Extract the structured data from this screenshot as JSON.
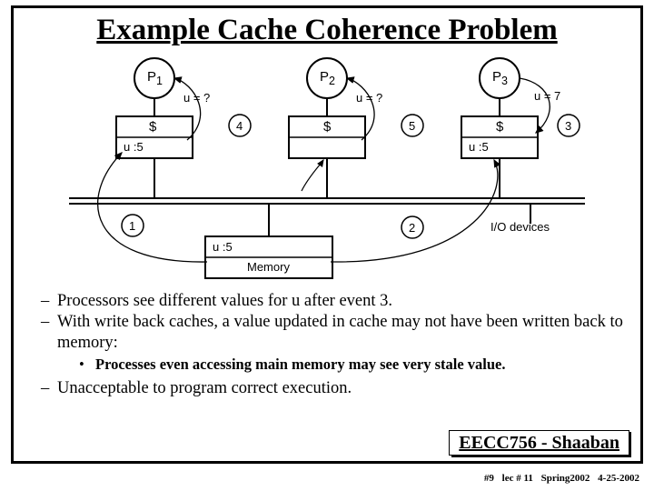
{
  "title": "Example Cache Coherence Problem",
  "diagram": {
    "proc1": "P",
    "proc1_sub": "1",
    "proc2": "P",
    "proc2_sub": "2",
    "proc3": "P",
    "proc3_sub": "3",
    "u_q1": "u = ?",
    "u_q2": "u = ?",
    "u_7": "u = 7",
    "cache1_line": "u :5",
    "cache2_label": "$",
    "cache1_label": "$",
    "cache3_label": "$",
    "cache3_line": "u :5",
    "step1": "1",
    "step2": "2",
    "step3": "3",
    "step4": "4",
    "step5": "5",
    "io": "I/O devices",
    "memory_label": "Memory",
    "memory_line": "u :5"
  },
  "bullets": {
    "b1": "Processors see different values for  u   after event 3.",
    "b2": "With write back caches, a value updated in cache may not have been written back to memory:",
    "b2a": "Processes even accessing main memory may see very stale value.",
    "b3": "Unacceptable to program correct execution."
  },
  "footer": {
    "course": "EECC756 - Shaaban",
    "slide_no": "#9",
    "lecture": "lec # 11",
    "term": "Spring2002",
    "date": "4-25-2002"
  }
}
